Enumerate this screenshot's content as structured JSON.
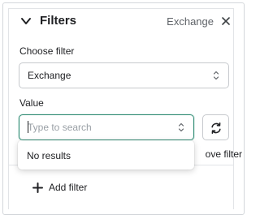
{
  "header": {
    "title": "Filters",
    "summary": "Exchange"
  },
  "choose_filter": {
    "label": "Choose filter",
    "selected": "Exchange"
  },
  "value": {
    "label": "Value",
    "placeholder": "Type to search",
    "dropdown_message": "No results"
  },
  "actions": {
    "remove_filter_visible": "ove filter",
    "add_filter": "Add filter"
  },
  "colors": {
    "accent": "#2e8b73",
    "border": "#c6c9cd",
    "text": "#202124"
  }
}
